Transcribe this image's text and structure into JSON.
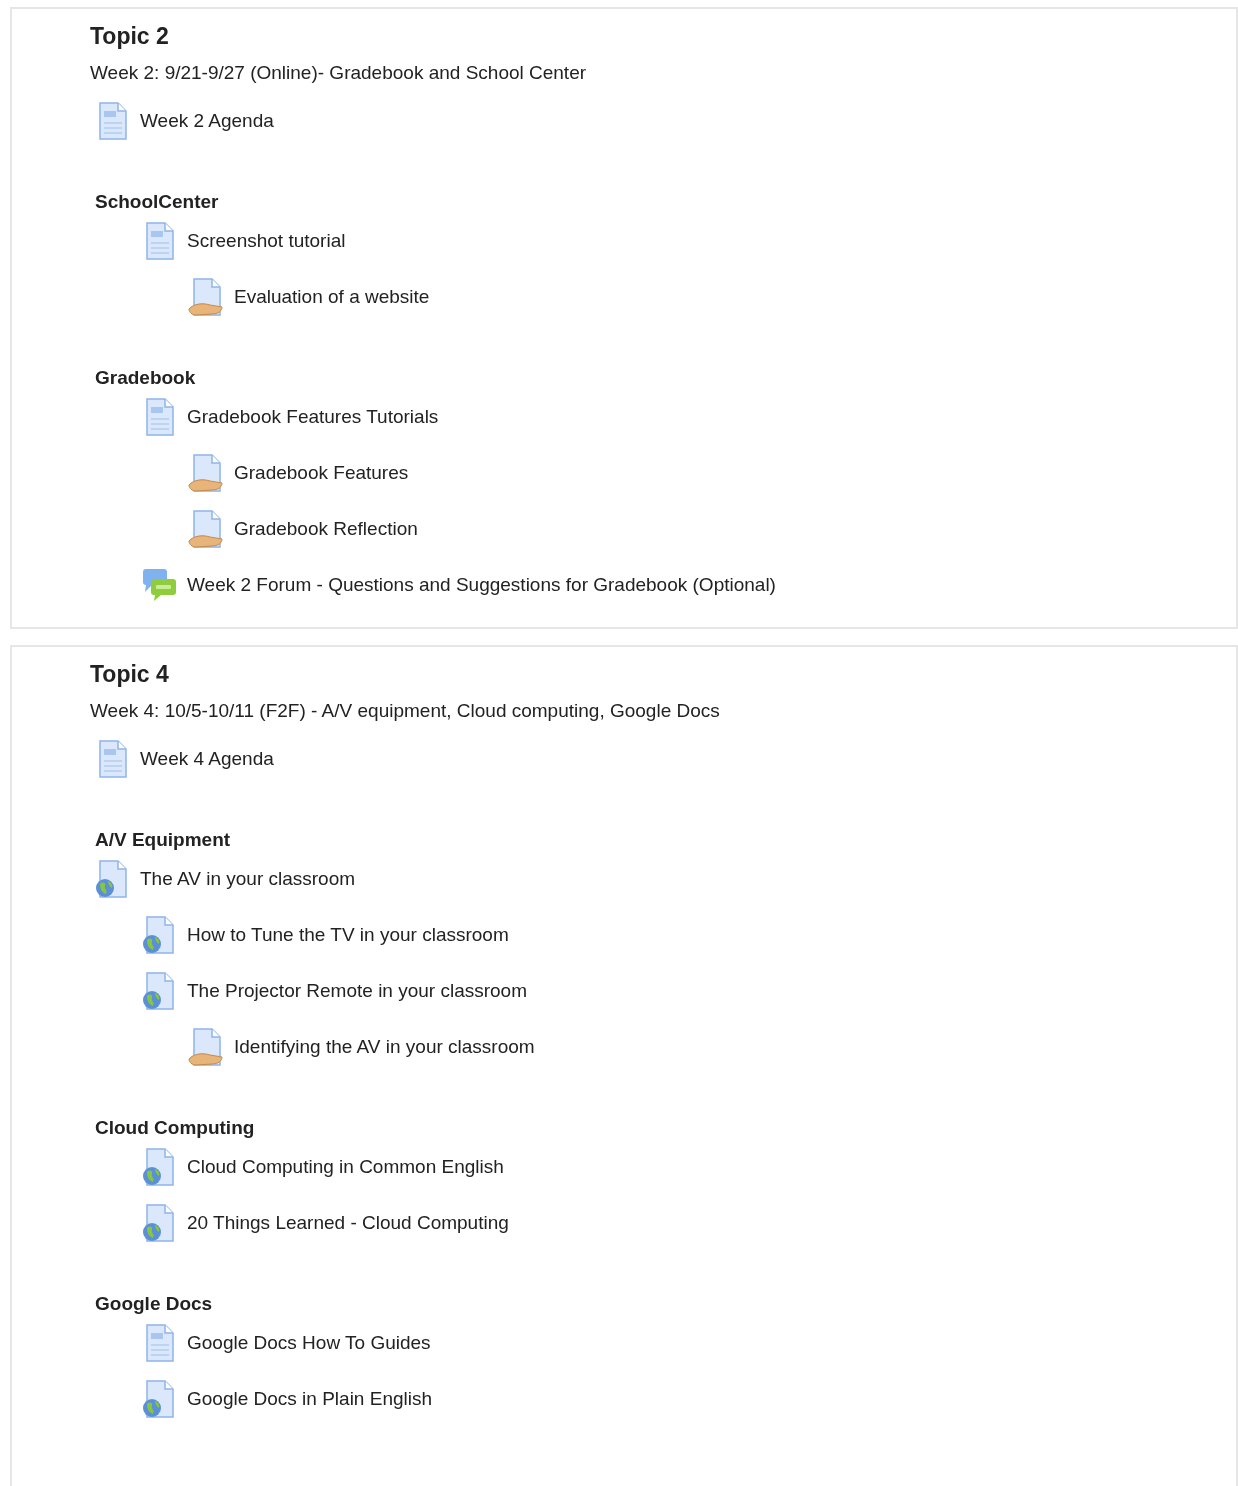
{
  "sections": [
    {
      "title": "Topic 2",
      "summary": "Week 2: 9/21-9/27 (Online)- Gradebook and School Center",
      "items": [
        {
          "kind": "page",
          "label": "Week 2 Agenda"
        },
        {
          "kind": "heading",
          "label": "SchoolCenter",
          "children": [
            {
              "kind": "page",
              "label": "Screenshot tutorial",
              "children": [
                {
                  "kind": "assignment",
                  "label": "Evaluation of a website"
                }
              ]
            }
          ]
        },
        {
          "kind": "heading",
          "label": "Gradebook",
          "children": [
            {
              "kind": "page",
              "label": "Gradebook Features Tutorials",
              "children": [
                {
                  "kind": "assignment",
                  "label": "Gradebook Features"
                },
                {
                  "kind": "assignment",
                  "label": "Gradebook Reflection"
                }
              ]
            },
            {
              "kind": "forum",
              "label": "Week 2 Forum - Questions and Suggestions for Gradebook (Optional)"
            }
          ]
        }
      ]
    },
    {
      "title": "Topic 4",
      "summary": "Week 4: 10/5-10/11 (F2F) - A/V equipment, Cloud computing, Google Docs",
      "items": [
        {
          "kind": "page",
          "label": "Week 4 Agenda"
        },
        {
          "kind": "heading",
          "label": "A/V Equipment"
        },
        {
          "kind": "url",
          "label": "The AV in your classroom",
          "children": [
            {
              "kind": "url",
              "label": "How to Tune the TV in your classroom"
            },
            {
              "kind": "url",
              "label": "The Projector Remote in your classroom",
              "children": [
                {
                  "kind": "assignment",
                  "label": "Identifying the AV in your classroom"
                }
              ]
            }
          ]
        },
        {
          "kind": "heading",
          "label": "Cloud Computing",
          "children": [
            {
              "kind": "url",
              "label": "Cloud Computing in Common English"
            },
            {
              "kind": "url",
              "label": "20 Things Learned - Cloud Computing"
            }
          ]
        },
        {
          "kind": "heading",
          "label": "Google Docs",
          "children": [
            {
              "kind": "page",
              "label": "Google Docs How To Guides"
            },
            {
              "kind": "url",
              "label": "Google Docs in Plain English"
            }
          ]
        }
      ]
    }
  ]
}
